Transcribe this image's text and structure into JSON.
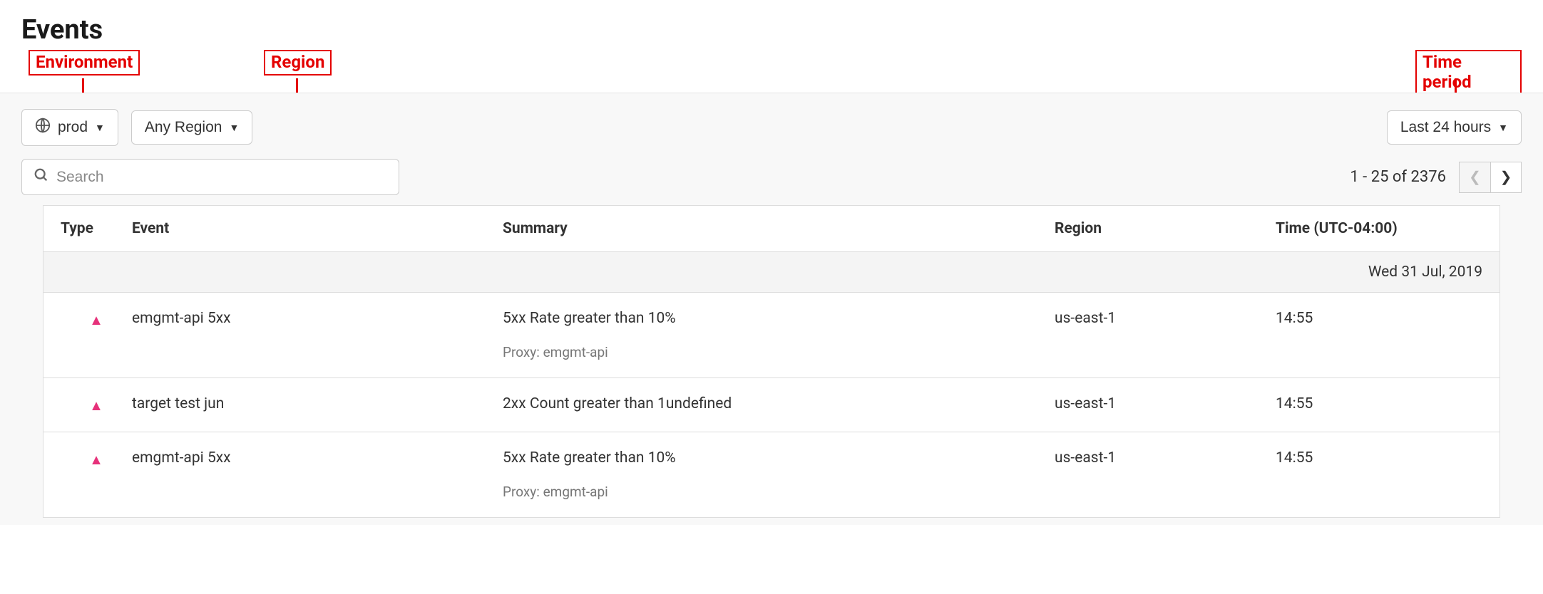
{
  "page": {
    "title": "Events"
  },
  "annotations": {
    "environment": "Environment",
    "region": "Region",
    "time_period": "Time period"
  },
  "filters": {
    "environment": {
      "value": "prod"
    },
    "region": {
      "value": "Any Region"
    },
    "time": {
      "value": "Last 24 hours"
    }
  },
  "search": {
    "placeholder": "Search",
    "value": ""
  },
  "pagination": {
    "text": "1 - 25 of 2376"
  },
  "columns": {
    "type": "Type",
    "event": "Event",
    "summary": "Summary",
    "region": "Region",
    "time": "Time (UTC-04:00)"
  },
  "groups": [
    {
      "date": "Wed 31 Jul, 2019",
      "rows": [
        {
          "type_icon": "alert-up",
          "event": "emgmt-api 5xx",
          "summary": "5xx Rate greater than 10%",
          "subtext": "Proxy: emgmt-api",
          "region": "us-east-1",
          "time": "14:55"
        },
        {
          "type_icon": "alert-up",
          "event": "target test jun",
          "summary": "2xx Count greater than 1undefined",
          "subtext": "",
          "region": "us-east-1",
          "time": "14:55"
        },
        {
          "type_icon": "alert-up",
          "event": "emgmt-api 5xx",
          "summary": "5xx Rate greater than 10%",
          "subtext": "Proxy: emgmt-api",
          "region": "us-east-1",
          "time": "14:55"
        }
      ]
    }
  ]
}
